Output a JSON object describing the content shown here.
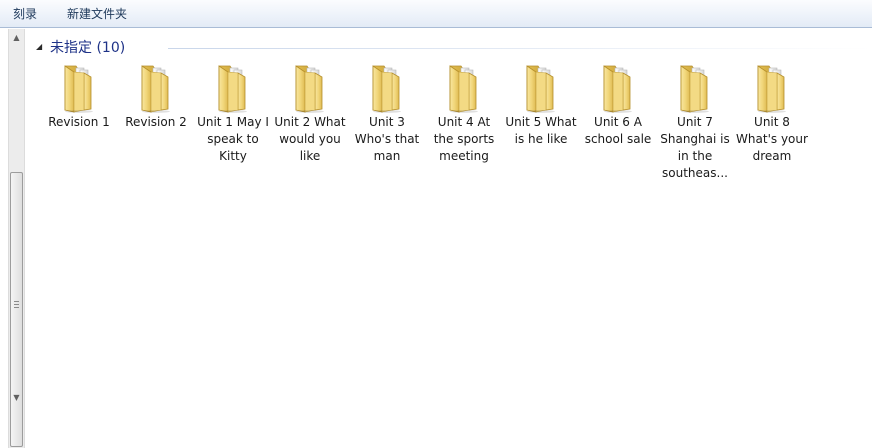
{
  "toolbar": {
    "burn_label": "刻录",
    "new_folder_label": "新建文件夹"
  },
  "group": {
    "title": "未指定 (10)",
    "chevron_icon": "chevron-expanded-icon"
  },
  "items": [
    {
      "label": "Revision 1",
      "icon": "folder-icon"
    },
    {
      "label": "Revision 2",
      "icon": "folder-icon"
    },
    {
      "label": "Unit 1 May I speak to Kitty",
      "icon": "folder-icon"
    },
    {
      "label": "Unit 2 What would you like",
      "icon": "folder-icon"
    },
    {
      "label": "Unit 3 Who's that man",
      "icon": "folder-icon"
    },
    {
      "label": "Unit 4 At the sports meeting",
      "icon": "folder-icon"
    },
    {
      "label": "Unit 5 What is he like",
      "icon": "folder-icon"
    },
    {
      "label": "Unit 6 A school sale",
      "icon": "folder-icon"
    },
    {
      "label": "Unit 7 Shanghai is in the southeas...",
      "icon": "folder-icon"
    },
    {
      "label": "Unit 8 What's your dream",
      "icon": "folder-icon"
    }
  ],
  "colors": {
    "group_title": "#1e3287",
    "folder_body": "#f2d77a",
    "folder_dark": "#d9b545"
  }
}
